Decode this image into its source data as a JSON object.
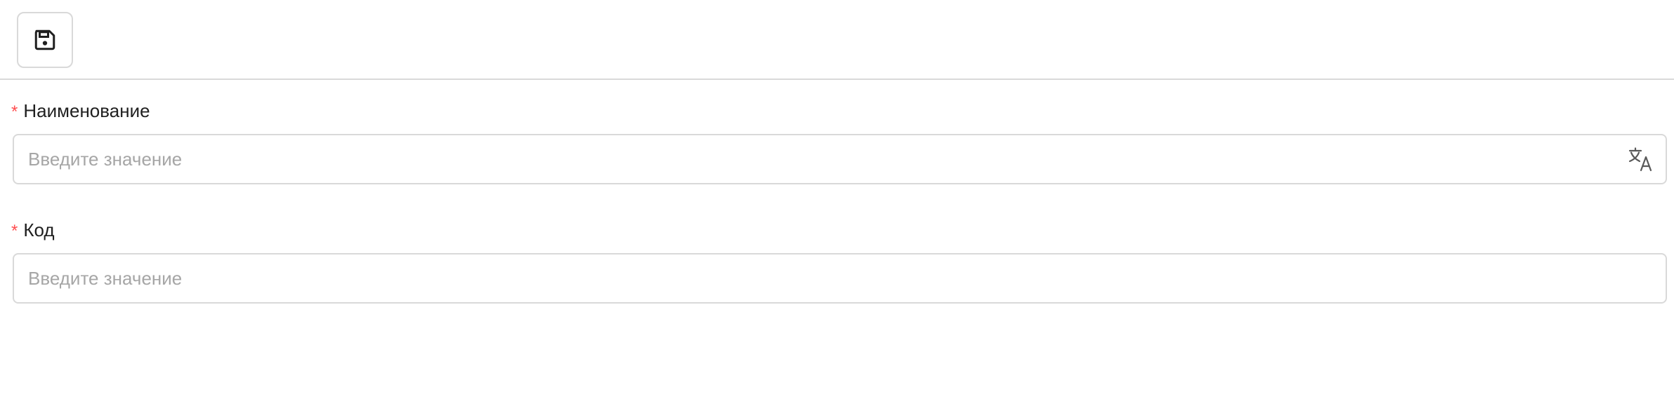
{
  "toolbar": {
    "save_icon": "save-icon"
  },
  "form": {
    "fields": [
      {
        "required_mark": "*",
        "label": "Наименование",
        "value": "",
        "placeholder": "Введите значение",
        "suffix_icon": "translate-icon"
      },
      {
        "required_mark": "*",
        "label": "Код",
        "value": "",
        "placeholder": "Введите значение"
      }
    ]
  },
  "colors": {
    "required_mark": "#ff4d4f",
    "border": "#d9d9d9",
    "placeholder": "#a6a6a6",
    "text": "#1f1f1f"
  }
}
